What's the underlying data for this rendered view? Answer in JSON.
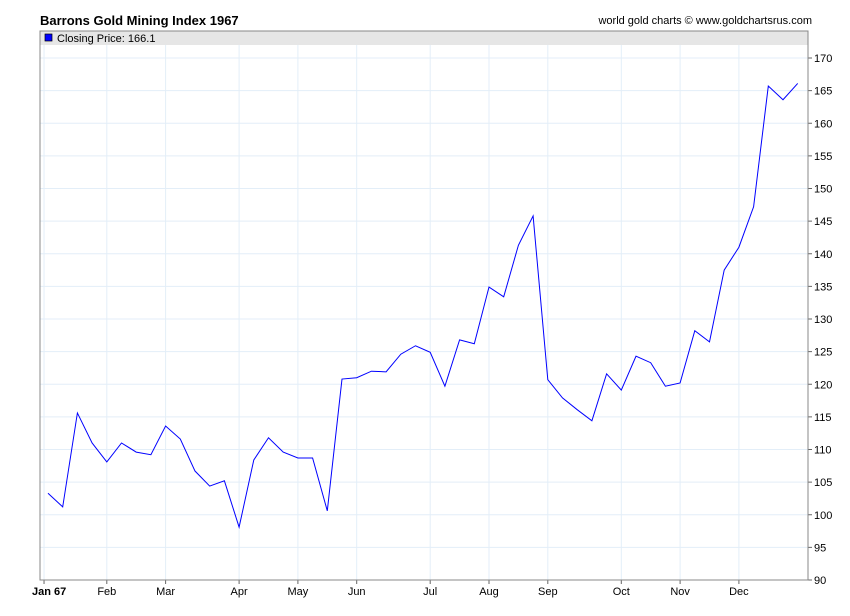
{
  "header": {
    "title": "Barrons Gold Mining Index 1967",
    "credit": "world gold charts © www.goldchartsrus.com"
  },
  "colors": {
    "line": "#0000ff",
    "grid": "#e3eef8",
    "legend_bg": "#e6e6e6"
  },
  "chart_data": {
    "type": "line",
    "title": "Barrons Gold Mining Index 1967",
    "legend": [
      {
        "label": "Closing Price: 166.1",
        "color": "#0000ff"
      }
    ],
    "legend_placement": "top-left",
    "ylim": [
      90,
      170
    ],
    "yticks": [
      90,
      95,
      100,
      105,
      110,
      115,
      120,
      125,
      130,
      135,
      140,
      145,
      150,
      155,
      160,
      165,
      170
    ],
    "xticks": [
      {
        "label": "Jan 67",
        "index": -0.27,
        "bold": true
      },
      {
        "label": "Feb",
        "index": 4
      },
      {
        "label": "Mar",
        "index": 8
      },
      {
        "label": "Apr",
        "index": 13
      },
      {
        "label": "May",
        "index": 17
      },
      {
        "label": "Jun",
        "index": 21
      },
      {
        "label": "Jul",
        "index": 26
      },
      {
        "label": "Aug",
        "index": 30
      },
      {
        "label": "Sep",
        "index": 34
      },
      {
        "label": "Oct",
        "index": 39
      },
      {
        "label": "Nov",
        "index": 43
      },
      {
        "label": "Dec",
        "index": 47
      }
    ],
    "grid": true,
    "series": [
      {
        "name": "Closing Price",
        "values": [
          103.3,
          101.2,
          115.6,
          111,
          108.1,
          111,
          109.6,
          109.2,
          113.6,
          111.6,
          106.7,
          104.4,
          105.2,
          98.1,
          108.4,
          111.8,
          109.6,
          108.7,
          108.7,
          100.6,
          120.8,
          121,
          122,
          121.9,
          124.6,
          125.9,
          124.9,
          119.7,
          126.8,
          126.2,
          134.9,
          133.4,
          141.3,
          145.8,
          120.7,
          117.9,
          116.1,
          114.4,
          121.6,
          119.1,
          124.3,
          123.3,
          119.7,
          120.2,
          128.2,
          126.5,
          137.5,
          141,
          147.2,
          165.7,
          163.6,
          166.1
        ]
      }
    ]
  }
}
